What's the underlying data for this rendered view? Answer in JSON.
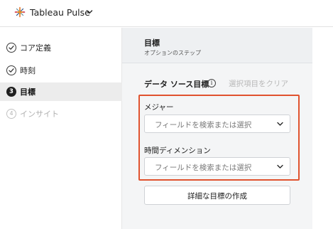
{
  "header": {
    "app_name": "Tableau Pulse",
    "logo_icon": "tableau-logo-icon",
    "menu_icon": "chevron-down-icon"
  },
  "steps": [
    {
      "label": "コア定義",
      "status": "completed",
      "icon": "check-circle-icon"
    },
    {
      "label": "時刻",
      "status": "completed",
      "icon": "check-circle-icon"
    },
    {
      "label": "目標",
      "status": "active",
      "number": "3"
    },
    {
      "label": "インサイト",
      "status": "pending",
      "number": "4"
    }
  ],
  "panel": {
    "title": "目標",
    "subtitle": "オプションのステップ",
    "section_title": "データ ソース目標",
    "info_icon": "info-icon",
    "clear_label": "選択項目をクリア",
    "fields": [
      {
        "label": "メジャー",
        "placeholder": "フィールドを検索または選択"
      },
      {
        "label": "時間ディメンション",
        "placeholder": "フィールドを検索または選択"
      }
    ],
    "create_button": "詳細な目標の作成"
  },
  "colors": {
    "highlight": "#e0532f",
    "active_step_bg": "#ececec",
    "panel_bg": "#f4f5f6"
  }
}
